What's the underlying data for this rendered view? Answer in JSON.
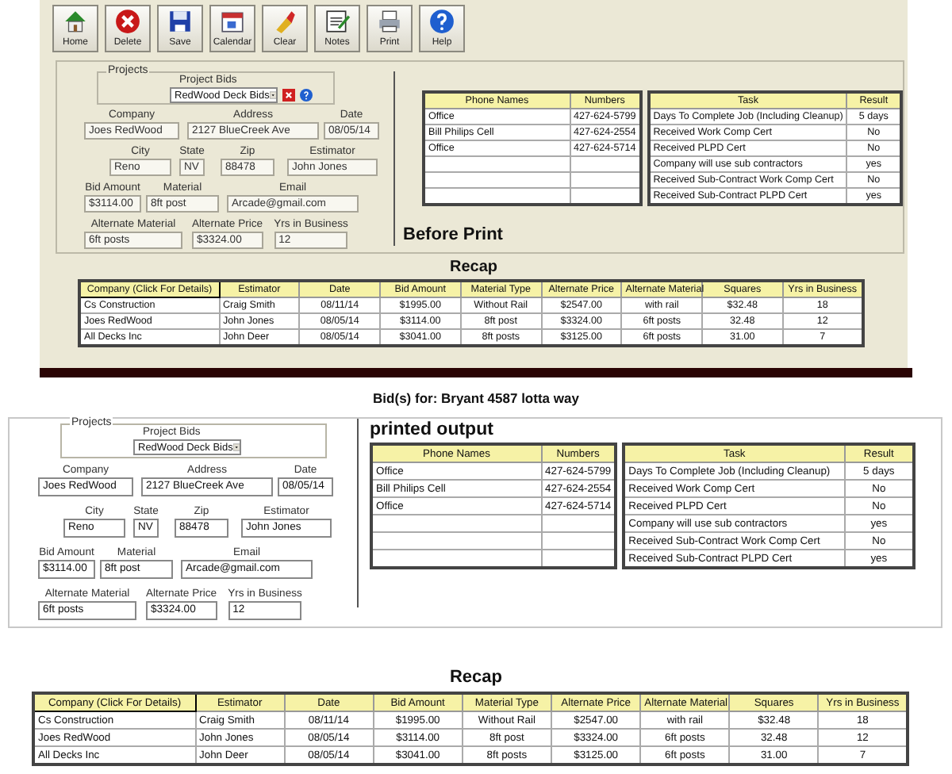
{
  "toolbar": [
    {
      "label": "Home"
    },
    {
      "label": "Delete"
    },
    {
      "label": "Save"
    },
    {
      "label": "Calendar"
    },
    {
      "label": "Clear"
    },
    {
      "label": "Notes"
    },
    {
      "label": "Print"
    },
    {
      "label": "Help"
    }
  ],
  "editor": {
    "projects_label": "Projects",
    "bids_label": "Project Bids",
    "bid": "RedWood Deck Bids",
    "fields": [
      [
        {
          "label": "Company",
          "value": "Joes RedWood"
        },
        {
          "label": "Address",
          "value": "2127 BlueCreek Ave"
        },
        {
          "label": "Date",
          "value": "08/05/14"
        }
      ],
      [
        {
          "label": "City",
          "value": "Reno"
        },
        {
          "label": "State",
          "value": "NV"
        },
        {
          "label": "Zip",
          "value": "88478"
        },
        {
          "label": "Estimator",
          "value": "John Jones"
        }
      ],
      [
        {
          "label": "Bid Amount",
          "value": "$3114.00"
        },
        {
          "label": "Material",
          "value": "8ft post"
        },
        {
          "label": "Email",
          "value": "Arcade@gmail.com"
        }
      ],
      [
        {
          "label": "Alternate Material",
          "value": "6ft posts"
        },
        {
          "label": "Alternate Price",
          "value": "$3324.00"
        },
        {
          "label": "Yrs in Business",
          "value": "12"
        }
      ]
    ],
    "phones": {
      "columns": [
        "Phone Names",
        "Numbers"
      ],
      "rows": [
        [
          "Office",
          "427-624-5799"
        ],
        [
          "Bill Philips Cell",
          "427-624-2554"
        ],
        [
          "Office",
          "427-624-5714"
        ]
      ]
    },
    "tasks": {
      "columns": [
        "Task",
        "Result"
      ],
      "rows": [
        [
          "Days To Complete Job (Including Cleanup)",
          "5 days"
        ],
        [
          "Received Work Comp Cert",
          "No"
        ],
        [
          "Received PLPD Cert",
          "No"
        ],
        [
          "Company will use sub contractors",
          "yes"
        ],
        [
          "Received Sub-Contract Work Comp Cert",
          "No"
        ],
        [
          "Received Sub-Contract PLPD Cert",
          "yes"
        ]
      ]
    },
    "caption": "Before Print",
    "recap": {
      "title": "Recap",
      "columns": [
        "Company (Click For Details)",
        "Estimator",
        "Date",
        "Bid Amount",
        "Material Type",
        "Alternate Price",
        "Alternate Material",
        "Squares",
        "Yrs in Business"
      ],
      "rows": [
        [
          "Cs Construction",
          "Craig Smith",
          "08/11/14",
          "$1995.00",
          "Without Rail",
          "$2547.00",
          "with rail",
          "$32.48",
          "18"
        ],
        [
          "Joes RedWood",
          "John Jones",
          "08/05/14",
          "$3114.00",
          "8ft post",
          "$3324.00",
          "6ft posts",
          "32.48",
          "12"
        ],
        [
          "All Decks Inc",
          "John Deer",
          "08/05/14",
          "$3041.00",
          "8ft posts",
          "$3125.00",
          "6ft posts",
          "31.00",
          "7"
        ]
      ]
    }
  },
  "print": {
    "heading": "Bid(s) for: Bryant 4587 lotta way",
    "projects_label": "Projects",
    "bids_label": "Project Bids",
    "bid": "RedWood Deck Bids",
    "fields": [
      [
        {
          "label": "Company",
          "value": "Joes RedWood"
        },
        {
          "label": "Address",
          "value": "2127 BlueCreek Ave"
        },
        {
          "label": "Date",
          "value": "08/05/14"
        }
      ],
      [
        {
          "label": "City",
          "value": "Reno"
        },
        {
          "label": "State",
          "value": "NV"
        },
        {
          "label": "Zip",
          "value": "88478"
        },
        {
          "label": "Estimator",
          "value": "John Jones"
        }
      ],
      [
        {
          "label": "Bid Amount",
          "value": "$3114.00"
        },
        {
          "label": "Material",
          "value": "8ft post"
        },
        {
          "label": "Email",
          "value": "Arcade@gmail.com"
        }
      ],
      [
        {
          "label": "Alternate Material",
          "value": "6ft posts"
        },
        {
          "label": "Alternate Price",
          "value": "$3324.00"
        },
        {
          "label": "Yrs in Business",
          "value": "12"
        }
      ]
    ],
    "phones": {
      "columns": [
        "Phone Names",
        "Numbers"
      ],
      "rows": [
        [
          "Office",
          "427-624-5799"
        ],
        [
          "Bill Philips Cell",
          "427-624-2554"
        ],
        [
          "Office",
          "427-624-5714"
        ]
      ]
    },
    "tasks": {
      "columns": [
        "Task",
        "Result"
      ],
      "rows": [
        [
          "Days To Complete Job (Including Cleanup)",
          "5 days"
        ],
        [
          "Received Work Comp Cert",
          "No"
        ],
        [
          "Received PLPD Cert",
          "No"
        ],
        [
          "Company will use sub contractors",
          "yes"
        ],
        [
          "Received Sub-Contract Work Comp Cert",
          "No"
        ],
        [
          "Received Sub-Contract PLPD Cert",
          "yes"
        ]
      ]
    },
    "caption": "printed output",
    "recap": {
      "title": "Recap",
      "columns": [
        "Company (Click For Details)",
        "Estimator",
        "Date",
        "Bid Amount",
        "Material Type",
        "Alternate Price",
        "Alternate Material",
        "Squares",
        "Yrs in Business"
      ],
      "rows": [
        [
          "Cs Construction",
          "Craig Smith",
          "08/11/14",
          "$1995.00",
          "Without Rail",
          "$2547.00",
          "with rail",
          "$32.48",
          "18"
        ],
        [
          "Joes RedWood",
          "John Jones",
          "08/05/14",
          "$3114.00",
          "8ft post",
          "$3324.00",
          "6ft posts",
          "32.48",
          "12"
        ],
        [
          "All Decks Inc",
          "John Deer",
          "08/05/14",
          "$3041.00",
          "8ft posts",
          "$3125.00",
          "6ft posts",
          "31.00",
          "7"
        ]
      ]
    }
  }
}
